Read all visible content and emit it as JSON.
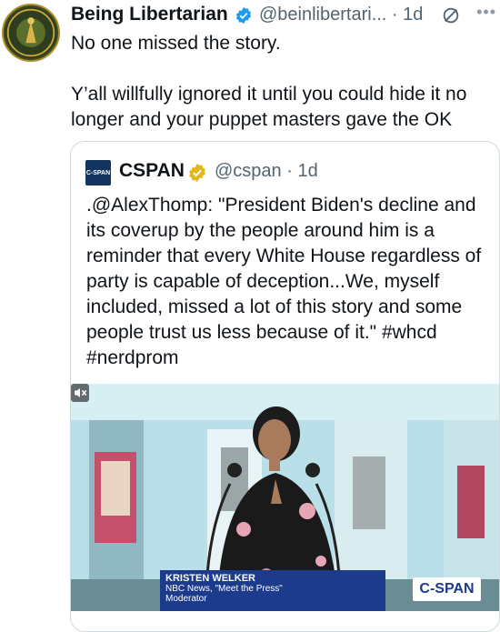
{
  "tweet": {
    "author_name": "Being Libertarian",
    "handle_time": "@beinlibertari... · 1d",
    "more_icon": "more-icon",
    "grok_icon": "grok-icon",
    "line1": "No one missed the story.",
    "paragraph2": "Y’all willfully ignored it until you could hide it no longer and your puppet masters gave the OK"
  },
  "quote": {
    "logo_text": "C-SPAN",
    "name": "CSPAN",
    "handle_time": "@cspan · 1d",
    "text": ".@AlexThomp: \"President Biden's decline and its coverup by the people around him is a reminder that every White House regardless of party is capable of deception...We, myself included, missed a lot of this story and some people trust us less because of it.\" #whcd #nerdprom",
    "video": {
      "lower_third_name": "KRISTEN WELKER",
      "lower_third_line2": "NBC News, \"Meet the Press\"",
      "lower_third_line3": "Moderator",
      "bug": "C-SPAN"
    }
  },
  "colors": {
    "text": "#0f1419",
    "secondary": "#536471",
    "verified": "#1d9bf0",
    "gold_verified": "#e2b719",
    "cspan_blue": "#1d3b8c"
  }
}
